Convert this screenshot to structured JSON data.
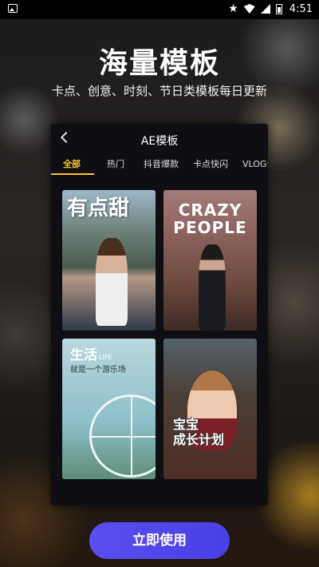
{
  "status_bar": {
    "time": "4:51"
  },
  "hero": {
    "title": "海量模板",
    "subtitle": "卡点、创意、时刻、节日类模板每日更新"
  },
  "preview": {
    "title": "AE模板",
    "tabs": [
      {
        "label": "全部",
        "active": true
      },
      {
        "label": "热门"
      },
      {
        "label": "抖音爆款"
      },
      {
        "label": "卡点快闪"
      },
      {
        "label": "VLOG记"
      }
    ],
    "cards": [
      {
        "text": "有点甜",
        "accent": "#ffffff"
      },
      {
        "text_line1": "CRAZY",
        "text_line2": "PEOPLE"
      },
      {
        "text": "生活",
        "tag": "LIFE",
        "sub": "就是一个游乐场"
      },
      {
        "text_line1": "宝宝",
        "text_line2": "成长计划"
      }
    ]
  },
  "cta": {
    "label": "立即使用",
    "color": "#5046ec"
  }
}
